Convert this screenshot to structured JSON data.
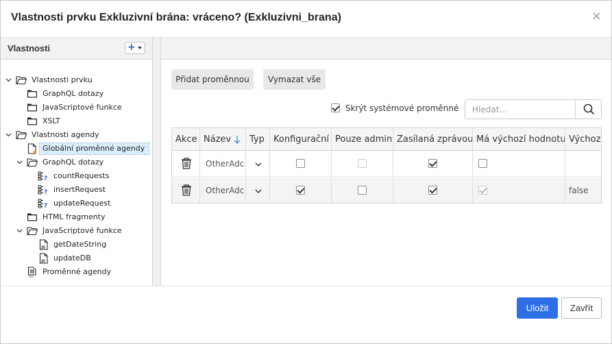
{
  "dialog": {
    "title": "Vlastnosti prvku Exkluzivní brána: vráceno? (Exkluzivni_brana)",
    "close_symbol": "×"
  },
  "left": {
    "header": "Vlastnosti",
    "add_symbol": "+",
    "tree": [
      {
        "label": "Vlastnosti prvku",
        "icon": "folder-open-icon"
      },
      {
        "label": "GraphQL dotazy",
        "icon": "folder-icon"
      },
      {
        "label": "JavaScriptové funkce",
        "icon": "folder-icon"
      },
      {
        "label": "XSLT",
        "icon": "folder-icon"
      },
      {
        "label": "Vlastnosti agendy",
        "icon": "folder-open-icon"
      },
      {
        "label": "Globální proměnné agendy",
        "icon": "document-edit-icon"
      },
      {
        "label": "GraphQL dotazy",
        "icon": "folder-open-icon"
      },
      {
        "label": "countRequests",
        "icon": "graphql-query-icon"
      },
      {
        "label": "insertRequest",
        "icon": "graphql-query-icon"
      },
      {
        "label": "updateRequest",
        "icon": "graphql-query-icon"
      },
      {
        "label": "HTML fragmenty",
        "icon": "folder-icon"
      },
      {
        "label": "JavaScriptové funkce",
        "icon": "folder-open-icon"
      },
      {
        "label": "getDateString",
        "icon": "js-file-icon"
      },
      {
        "label": "updateDB",
        "icon": "js-file-icon"
      },
      {
        "label": "Proměnné agendy",
        "icon": "variables-icon"
      }
    ]
  },
  "toolbar": {
    "add_variable": "Přidat proměnnou",
    "delete_all": "Vymazat vše",
    "hide_system": "Skrýt systémové proměnné",
    "hide_system_checked": true,
    "search_placeholder": "Hledat..."
  },
  "table": {
    "columns": [
      "Akce",
      "Název",
      "Typ",
      "Konfigurační",
      "Pouze admin",
      "Zasílaná zprávou",
      "Má výchozí hodnotu",
      "Výchozí"
    ],
    "rows": [
      {
        "name": "OtherAdc",
        "konfiguracni": false,
        "pouze_admin": false,
        "zasilana": true,
        "ma_vychozi": false,
        "vychozi": ""
      },
      {
        "name": "OtherAdc",
        "konfiguracni": true,
        "pouze_admin": false,
        "zasilana": true,
        "ma_vychozi": true,
        "vychozi": "false"
      }
    ]
  },
  "footer": {
    "save": "Uložit",
    "close": "Zavřít"
  },
  "colors": {
    "primary": "#2f6fe6",
    "selected_bg": "#dbeefb"
  }
}
